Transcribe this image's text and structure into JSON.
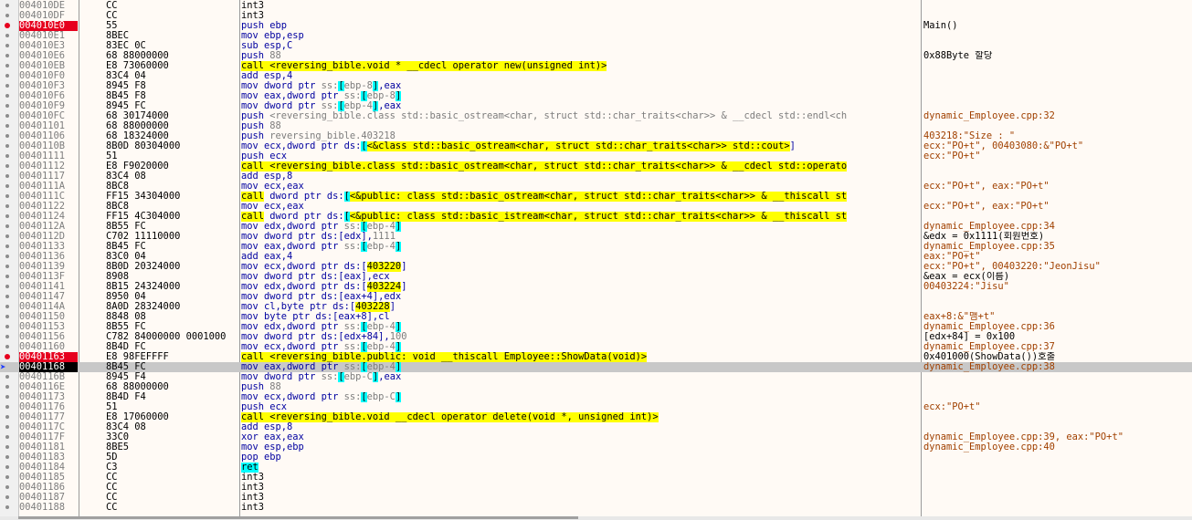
{
  "rows": [
    {
      "addr": "004010DE",
      "hex": "CC",
      "ops": [
        {
          "t": "int3",
          "k": "plain"
        }
      ],
      "cmt": "",
      "mark": "dot"
    },
    {
      "addr": "004010DF",
      "hex": "CC",
      "ops": [
        {
          "t": "int3",
          "k": "plain"
        }
      ],
      "cmt": "",
      "mark": "dot"
    },
    {
      "addr": "004010E0",
      "hex": "55",
      "ops": [
        {
          "t": "push ",
          "k": "std"
        },
        {
          "t": "ebp",
          "k": "std"
        }
      ],
      "cmt": "Main()",
      "mark": "bp",
      "addrstyle": "bp"
    },
    {
      "addr": "004010E1",
      "hex": "8BEC",
      "ops": [
        {
          "t": "mov ebp,esp",
          "k": "std"
        }
      ],
      "cmt": "",
      "mark": "dot"
    },
    {
      "addr": "004010E3",
      "hex": "83EC 0C",
      "ops": [
        {
          "t": "sub esp,C",
          "k": "std"
        }
      ],
      "cmt": "",
      "mark": "dot"
    },
    {
      "addr": "004010E6",
      "hex": "68 88000000",
      "ops": [
        {
          "t": "push ",
          "k": "std"
        },
        {
          "t": "88",
          "k": "gry"
        }
      ],
      "cmt": "0x88Byte 할당",
      "mark": "dot"
    },
    {
      "addr": "004010EB",
      "hex": "E8 73060000",
      "ops": [
        {
          "t": "call <reversing_bible.void * __cdecl operator new(unsigned int)>",
          "k": "call"
        }
      ],
      "cmt": "",
      "mark": "dot"
    },
    {
      "addr": "004010F0",
      "hex": "83C4 04",
      "ops": [
        {
          "t": "add esp,4",
          "k": "std"
        }
      ],
      "cmt": "",
      "mark": "dot"
    },
    {
      "addr": "004010F3",
      "hex": "8945 F8",
      "ops": [
        {
          "t": "mov dword ptr ",
          "k": "std"
        },
        {
          "t": "ss:",
          "k": "gry"
        },
        {
          "t": "[",
          "k": "br"
        },
        {
          "t": "ebp-8",
          "k": "gry"
        },
        {
          "t": "]",
          "k": "br"
        },
        {
          "t": ",eax",
          "k": "std"
        }
      ],
      "cmt": "",
      "mark": "dot"
    },
    {
      "addr": "004010F6",
      "hex": "8B45 F8",
      "ops": [
        {
          "t": "mov eax,dword ptr ",
          "k": "std"
        },
        {
          "t": "ss:",
          "k": "gry"
        },
        {
          "t": "[",
          "k": "br"
        },
        {
          "t": "ebp-8",
          "k": "gry"
        },
        {
          "t": "]",
          "k": "br"
        }
      ],
      "cmt": "",
      "mark": "dot"
    },
    {
      "addr": "004010F9",
      "hex": "8945 FC",
      "ops": [
        {
          "t": "mov dword ptr ",
          "k": "std"
        },
        {
          "t": "ss:",
          "k": "gry"
        },
        {
          "t": "[",
          "k": "br"
        },
        {
          "t": "ebp-4",
          "k": "gry"
        },
        {
          "t": "]",
          "k": "br"
        },
        {
          "t": ",eax",
          "k": "std"
        }
      ],
      "cmt": "",
      "mark": "dot"
    },
    {
      "addr": "004010FC",
      "hex": "68 30174000",
      "ops": [
        {
          "t": "push ",
          "k": "std"
        },
        {
          "t": "<reversing_bible.class std::basic_ostream<char, struct std::char_traits<char>> & __cdecl std::endl<ch",
          "k": "gry"
        }
      ],
      "cmt": "dynamic_Employee.cpp:32",
      "cmtk": "dyn",
      "mark": "dot"
    },
    {
      "addr": "00401101",
      "hex": "68 88000000",
      "ops": [
        {
          "t": "push ",
          "k": "std"
        },
        {
          "t": "88",
          "k": "gry"
        }
      ],
      "cmt": "",
      "mark": "dot"
    },
    {
      "addr": "00401106",
      "hex": "68 18324000",
      "ops": [
        {
          "t": "push ",
          "k": "std"
        },
        {
          "t": "reversing_bible.403218",
          "k": "gry"
        }
      ],
      "cmt": "403218:\"Size : \"",
      "cmtk": "dyn",
      "mark": "dot"
    },
    {
      "addr": "0040110B",
      "hex": "8B0D 80304000",
      "ops": [
        {
          "t": "mov ecx,dword ptr ",
          "k": "std"
        },
        {
          "t": "ds:",
          "k": "std"
        },
        {
          "t": "[",
          "k": "br"
        },
        {
          "t": "<&class std::basic_ostream<char, struct std::char_traits<char>> std::cout>",
          "k": "yel"
        },
        {
          "t": "]",
          "k": "std"
        }
      ],
      "cmt": "ecx:\"PO+t\", 00403080:&\"PO+t\"",
      "cmtk": "dyn",
      "mark": "dot"
    },
    {
      "addr": "00401111",
      "hex": "51",
      "ops": [
        {
          "t": "push ecx",
          "k": "std"
        }
      ],
      "cmt": "ecx:\"PO+t\"",
      "cmtk": "dyn",
      "mark": "dot"
    },
    {
      "addr": "00401112",
      "hex": "E8 F9020000",
      "ops": [
        {
          "t": "call <reversing_bible.class std::basic_ostream<char, struct std::char_traits<char>> & __cdecl std::operato",
          "k": "call"
        }
      ],
      "cmt": "",
      "mark": "dot"
    },
    {
      "addr": "00401117",
      "hex": "83C4 08",
      "ops": [
        {
          "t": "add esp,8",
          "k": "std"
        }
      ],
      "cmt": "",
      "mark": "dot"
    },
    {
      "addr": "0040111A",
      "hex": "8BC8",
      "ops": [
        {
          "t": "mov ecx,eax",
          "k": "std"
        }
      ],
      "cmt": "ecx:\"PO+t\", eax:\"PO+t\"",
      "cmtk": "dyn",
      "mark": "dot"
    },
    {
      "addr": "0040111C",
      "hex": "FF15 34304000",
      "ops": [
        {
          "t": "call",
          "k": "call"
        },
        {
          "t": " dword ptr ",
          "k": "std"
        },
        {
          "t": "ds:",
          "k": "std"
        },
        {
          "t": "[",
          "k": "br"
        },
        {
          "t": "<&public: class std::basic_ostream<char, struct std::char_traits<char>> & __thiscall st",
          "k": "yel"
        }
      ],
      "cmt": "",
      "mark": "dot"
    },
    {
      "addr": "00401122",
      "hex": "8BC8",
      "ops": [
        {
          "t": "mov ecx,eax",
          "k": "std"
        }
      ],
      "cmt": "ecx:\"PO+t\", eax:\"PO+t\"",
      "cmtk": "dyn",
      "mark": "dot"
    },
    {
      "addr": "00401124",
      "hex": "FF15 4C304000",
      "ops": [
        {
          "t": "call",
          "k": "call"
        },
        {
          "t": " dword ptr ",
          "k": "std"
        },
        {
          "t": "ds:",
          "k": "std"
        },
        {
          "t": "[",
          "k": "br"
        },
        {
          "t": "<&public: class std::basic_istream<char, struct std::char_traits<char>> & __thiscall st",
          "k": "yel"
        }
      ],
      "cmt": "",
      "mark": "dot"
    },
    {
      "addr": "0040112A",
      "hex": "8B55 FC",
      "ops": [
        {
          "t": "mov edx,dword ptr ",
          "k": "std"
        },
        {
          "t": "ss:",
          "k": "gry"
        },
        {
          "t": "[",
          "k": "br"
        },
        {
          "t": "ebp-4",
          "k": "gry"
        },
        {
          "t": "]",
          "k": "br"
        }
      ],
      "cmt": "dynamic_Employee.cpp:34",
      "cmtk": "dyn",
      "mark": "dot"
    },
    {
      "addr": "0040112D",
      "hex": "C702 11110000",
      "ops": [
        {
          "t": "mov dword ptr ",
          "k": "std"
        },
        {
          "t": "ds:",
          "k": "std"
        },
        {
          "t": "[edx],",
          "k": "std"
        },
        {
          "t": "1111",
          "k": "gry"
        }
      ],
      "cmt": "&edx = 0x1111(회원번호)",
      "mark": "dot"
    },
    {
      "addr": "00401133",
      "hex": "8B45 FC",
      "ops": [
        {
          "t": "mov eax,dword ptr ",
          "k": "std"
        },
        {
          "t": "ss:",
          "k": "gry"
        },
        {
          "t": "[",
          "k": "br"
        },
        {
          "t": "ebp-4",
          "k": "gry"
        },
        {
          "t": "]",
          "k": "br"
        }
      ],
      "cmt": "dynamic_Employee.cpp:35",
      "cmtk": "dyn",
      "mark": "dot"
    },
    {
      "addr": "00401136",
      "hex": "83C0 04",
      "ops": [
        {
          "t": "add eax,4",
          "k": "std"
        }
      ],
      "cmt": "eax:\"PO+t\"",
      "cmtk": "dyn",
      "mark": "dot"
    },
    {
      "addr": "00401139",
      "hex": "8B0D 20324000",
      "ops": [
        {
          "t": "mov ecx,dword ptr ",
          "k": "std"
        },
        {
          "t": "ds:",
          "k": "std"
        },
        {
          "t": "[",
          "k": "std"
        },
        {
          "t": "403220",
          "k": "yel"
        },
        {
          "t": "]",
          "k": "std"
        }
      ],
      "cmt": "ecx:\"PO+t\", 00403220:\"JeonJisu\"",
      "cmtk": "dyn",
      "mark": "dot"
    },
    {
      "addr": "0040113F",
      "hex": "8908",
      "ops": [
        {
          "t": "mov dword ptr ",
          "k": "std"
        },
        {
          "t": "ds:",
          "k": "std"
        },
        {
          "t": "[eax],ecx",
          "k": "std"
        }
      ],
      "cmt": "&eax = ecx(이름)",
      "mark": "dot"
    },
    {
      "addr": "00401141",
      "hex": "8B15 24324000",
      "ops": [
        {
          "t": "mov edx,dword ptr ",
          "k": "std"
        },
        {
          "t": "ds:",
          "k": "std"
        },
        {
          "t": "[",
          "k": "std"
        },
        {
          "t": "403224",
          "k": "yel"
        },
        {
          "t": "]",
          "k": "std"
        }
      ],
      "cmt": "00403224:\"Jisu\"",
      "cmtk": "dyn",
      "mark": "dot"
    },
    {
      "addr": "00401147",
      "hex": "8950 04",
      "ops": [
        {
          "t": "mov dword ptr ",
          "k": "std"
        },
        {
          "t": "ds:",
          "k": "std"
        },
        {
          "t": "[eax+4],edx",
          "k": "std"
        }
      ],
      "cmt": "",
      "mark": "dot"
    },
    {
      "addr": "0040114A",
      "hex": "8A0D 28324000",
      "ops": [
        {
          "t": "mov cl,byte ptr ",
          "k": "std"
        },
        {
          "t": "ds:",
          "k": "std"
        },
        {
          "t": "[",
          "k": "std"
        },
        {
          "t": "403228",
          "k": "yel"
        },
        {
          "t": "]",
          "k": "std"
        }
      ],
      "cmt": "",
      "mark": "dot"
    },
    {
      "addr": "00401150",
      "hex": "8848 08",
      "ops": [
        {
          "t": "mov byte ptr ",
          "k": "std"
        },
        {
          "t": "ds:",
          "k": "std"
        },
        {
          "t": "[eax+8],cl",
          "k": "std"
        }
      ],
      "cmt": "eax+8:&\"맴+t\"",
      "cmtk": "dyn",
      "mark": "dot"
    },
    {
      "addr": "00401153",
      "hex": "8B55 FC",
      "ops": [
        {
          "t": "mov edx,dword ptr ",
          "k": "std"
        },
        {
          "t": "ss:",
          "k": "gry"
        },
        {
          "t": "[",
          "k": "br"
        },
        {
          "t": "ebp-4",
          "k": "gry"
        },
        {
          "t": "]",
          "k": "br"
        }
      ],
      "cmt": "dynamic_Employee.cpp:36",
      "cmtk": "dyn",
      "mark": "dot"
    },
    {
      "addr": "00401156",
      "hex": "C782 84000000 0001000",
      "ops": [
        {
          "t": "mov dword ptr ",
          "k": "std"
        },
        {
          "t": "ds:",
          "k": "std"
        },
        {
          "t": "[edx+84],",
          "k": "std"
        },
        {
          "t": "100",
          "k": "gry"
        }
      ],
      "cmt": "[edx+84] = 0x100",
      "mark": "dot"
    },
    {
      "addr": "00401160",
      "hex": "8B4D FC",
      "ops": [
        {
          "t": "mov ecx,dword ptr ",
          "k": "std"
        },
        {
          "t": "ss:",
          "k": "gry"
        },
        {
          "t": "[",
          "k": "br"
        },
        {
          "t": "ebp-4",
          "k": "gry"
        },
        {
          "t": "]",
          "k": "br"
        }
      ],
      "cmt": "dynamic_Employee.cpp:37",
      "cmtk": "dyn",
      "mark": "dot"
    },
    {
      "addr": "00401163",
      "hex": "E8 98FEFFFF",
      "ops": [
        {
          "t": "call <reversing_bible.public: void __thiscall Employee::ShowData(void)>",
          "k": "call"
        }
      ],
      "cmt": "0x401000(ShowData())호출",
      "mark": "bp",
      "addrstyle": "bp"
    },
    {
      "addr": "00401168",
      "hex": "8B45 FC",
      "ops": [
        {
          "t": "mov eax,dword ptr ",
          "k": "std"
        },
        {
          "t": "ss:",
          "k": "gry"
        },
        {
          "t": "[",
          "k": "br"
        },
        {
          "t": "ebp-4",
          "k": "gry"
        },
        {
          "t": "]",
          "k": "br"
        }
      ],
      "cmt": "dynamic_Employee.cpp:38",
      "cmtk": "dyn",
      "mark": "eip",
      "addrstyle": "eip",
      "current": true
    },
    {
      "addr": "0040116B",
      "hex": "8945 F4",
      "ops": [
        {
          "t": "mov dword ptr ",
          "k": "std"
        },
        {
          "t": "ss:",
          "k": "gry"
        },
        {
          "t": "[",
          "k": "br"
        },
        {
          "t": "ebp-C",
          "k": "gry"
        },
        {
          "t": "]",
          "k": "br"
        },
        {
          "t": ",eax",
          "k": "std"
        }
      ],
      "cmt": "",
      "mark": "dot"
    },
    {
      "addr": "0040116E",
      "hex": "68 88000000",
      "ops": [
        {
          "t": "push ",
          "k": "std"
        },
        {
          "t": "88",
          "k": "gry"
        }
      ],
      "cmt": "",
      "mark": "dot"
    },
    {
      "addr": "00401173",
      "hex": "8B4D F4",
      "ops": [
        {
          "t": "mov ecx,dword ptr ",
          "k": "std"
        },
        {
          "t": "ss:",
          "k": "gry"
        },
        {
          "t": "[",
          "k": "br"
        },
        {
          "t": "ebp-C",
          "k": "gry"
        },
        {
          "t": "]",
          "k": "br"
        }
      ],
      "cmt": "",
      "mark": "dot"
    },
    {
      "addr": "00401176",
      "hex": "51",
      "ops": [
        {
          "t": "push ecx",
          "k": "std"
        }
      ],
      "cmt": "ecx:\"PO+t\"",
      "cmtk": "dyn",
      "mark": "dot"
    },
    {
      "addr": "00401177",
      "hex": "E8 17060000",
      "ops": [
        {
          "t": "call <reversing_bible.void __cdecl operator delete(void *, unsigned int)>",
          "k": "call"
        }
      ],
      "cmt": "",
      "mark": "dot"
    },
    {
      "addr": "0040117C",
      "hex": "83C4 08",
      "ops": [
        {
          "t": "add esp,8",
          "k": "std"
        }
      ],
      "cmt": "",
      "mark": "dot"
    },
    {
      "addr": "0040117F",
      "hex": "33C0",
      "ops": [
        {
          "t": "xor eax,eax",
          "k": "std"
        }
      ],
      "cmt": "dynamic_Employee.cpp:39, eax:\"PO+t\"",
      "cmtk": "dyn",
      "mark": "dot"
    },
    {
      "addr": "00401181",
      "hex": "8BE5",
      "ops": [
        {
          "t": "mov esp,ebp",
          "k": "std"
        }
      ],
      "cmt": "dynamic_Employee.cpp:40",
      "cmtk": "dyn",
      "mark": "dot"
    },
    {
      "addr": "00401183",
      "hex": "5D",
      "ops": [
        {
          "t": "pop ebp",
          "k": "std"
        }
      ],
      "cmt": "",
      "mark": "dot"
    },
    {
      "addr": "00401184",
      "hex": "C3",
      "ops": [
        {
          "t": "ret",
          "k": "jmp"
        }
      ],
      "cmt": "",
      "mark": "dot"
    },
    {
      "addr": "00401185",
      "hex": "CC",
      "ops": [
        {
          "t": "int3",
          "k": "plain"
        }
      ],
      "cmt": "",
      "mark": "dot"
    },
    {
      "addr": "00401186",
      "hex": "CC",
      "ops": [
        {
          "t": "int3",
          "k": "plain"
        }
      ],
      "cmt": "",
      "mark": "dot"
    },
    {
      "addr": "00401187",
      "hex": "CC",
      "ops": [
        {
          "t": "int3",
          "k": "plain"
        }
      ],
      "cmt": "",
      "mark": "dot"
    },
    {
      "addr": "00401188",
      "hex": "CC",
      "ops": [
        {
          "t": "int3",
          "k": "plain"
        }
      ],
      "cmt": "",
      "mark": "dot"
    }
  ],
  "colors": {
    "breakpoint": "#e6001e",
    "current_row": "#c8c8c8",
    "call_highlight": "#ffff00",
    "ret_highlight": "#00ffff",
    "comment_auto": "#a04000",
    "eip_arrow": "#1e3cff"
  },
  "icons": {
    "breakpoint": "breakpoint-dot-icon",
    "eip": "eip-arrow-icon"
  }
}
